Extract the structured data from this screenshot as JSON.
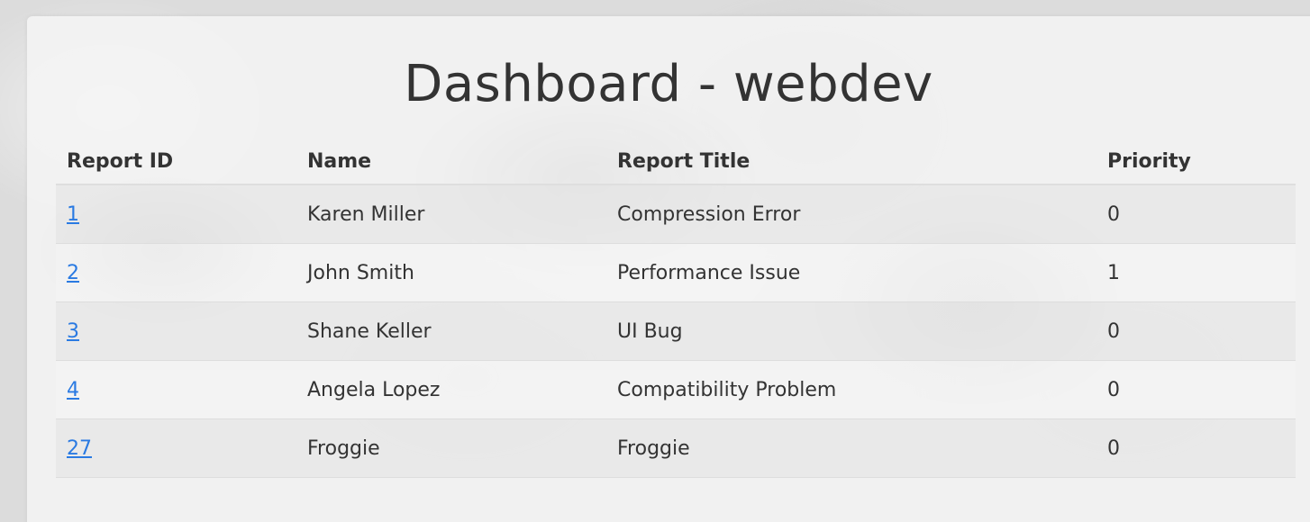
{
  "page": {
    "title": "Dashboard - webdev"
  },
  "table": {
    "headers": {
      "report_id": "Report ID",
      "name": "Name",
      "report_title": "Report Title",
      "priority": "Priority"
    },
    "rows": [
      {
        "report_id": "1",
        "name": "Karen Miller",
        "report_title": "Compression Error",
        "priority": "0"
      },
      {
        "report_id": "2",
        "name": "John Smith",
        "report_title": "Performance Issue",
        "priority": "1"
      },
      {
        "report_id": "3",
        "name": "Shane Keller",
        "report_title": "UI Bug",
        "priority": "0"
      },
      {
        "report_id": "4",
        "name": "Angela Lopez",
        "report_title": "Compatibility Problem",
        "priority": "0"
      },
      {
        "report_id": "27",
        "name": "Froggie",
        "report_title": "Froggie",
        "priority": "0"
      }
    ]
  },
  "colors": {
    "link": "#2a7ae2",
    "text": "#333333"
  }
}
